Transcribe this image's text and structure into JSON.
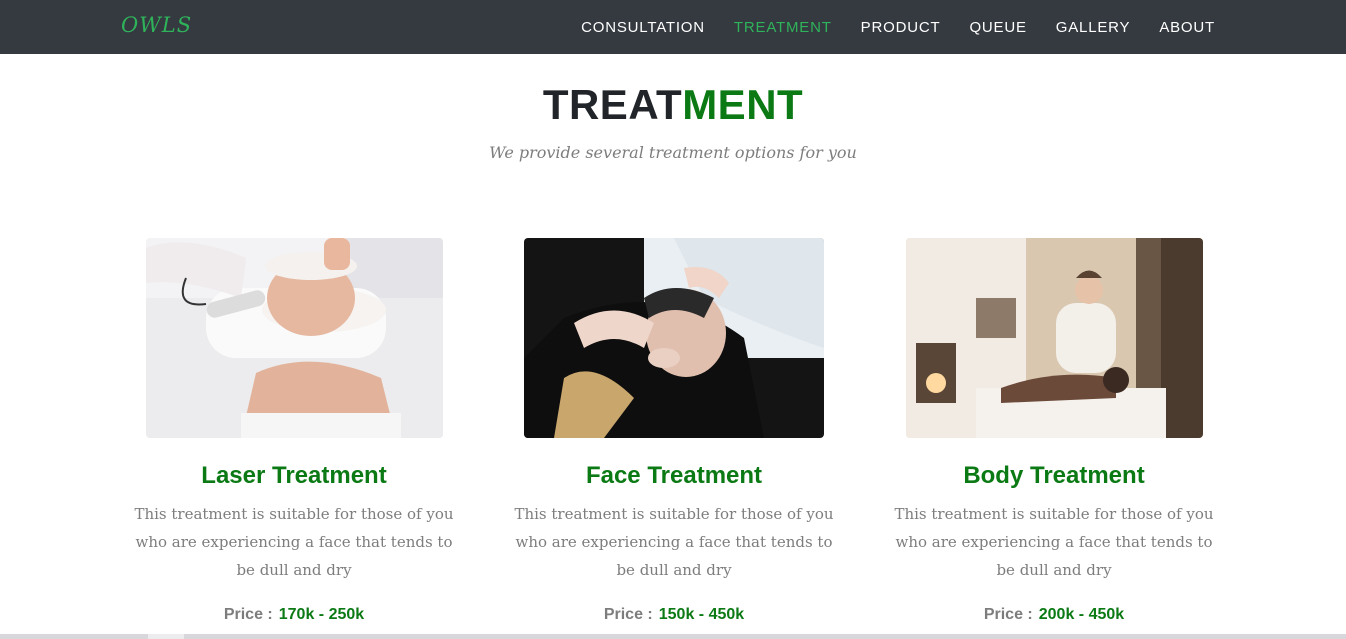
{
  "nav": {
    "brand": "OWLS",
    "links": [
      "CONSULTATION",
      "TREATMENT",
      "PRODUCT",
      "QUEUE",
      "GALLERY",
      "ABOUT"
    ],
    "active": "TREATMENT"
  },
  "section": {
    "title_part1": "TREAT",
    "title_part2": "MENT",
    "subtitle": "We provide several treatment options for you"
  },
  "cards": [
    {
      "title": "Laser Treatment",
      "description": "This treatment is suitable for those of you who are experiencing a face that tends to be dull and dry",
      "price_label": "Price :",
      "price_value": "170k - 250k"
    },
    {
      "title": "Face Treatment",
      "description": "This treatment is suitable for those of you who are experiencing a face that tends to be dull and dry",
      "price_label": "Price :",
      "price_value": "150k - 450k"
    },
    {
      "title": "Body Treatment",
      "description": "This treatment is suitable for those of you who are experiencing a face that tends to be dull and dry",
      "price_label": "Price :",
      "price_value": "200k - 450k"
    }
  ],
  "colors": {
    "navbar_bg": "#343a40",
    "accent_green": "#2fb35a",
    "title_green": "#0b7a14",
    "text_grey": "#7d7d7d"
  }
}
